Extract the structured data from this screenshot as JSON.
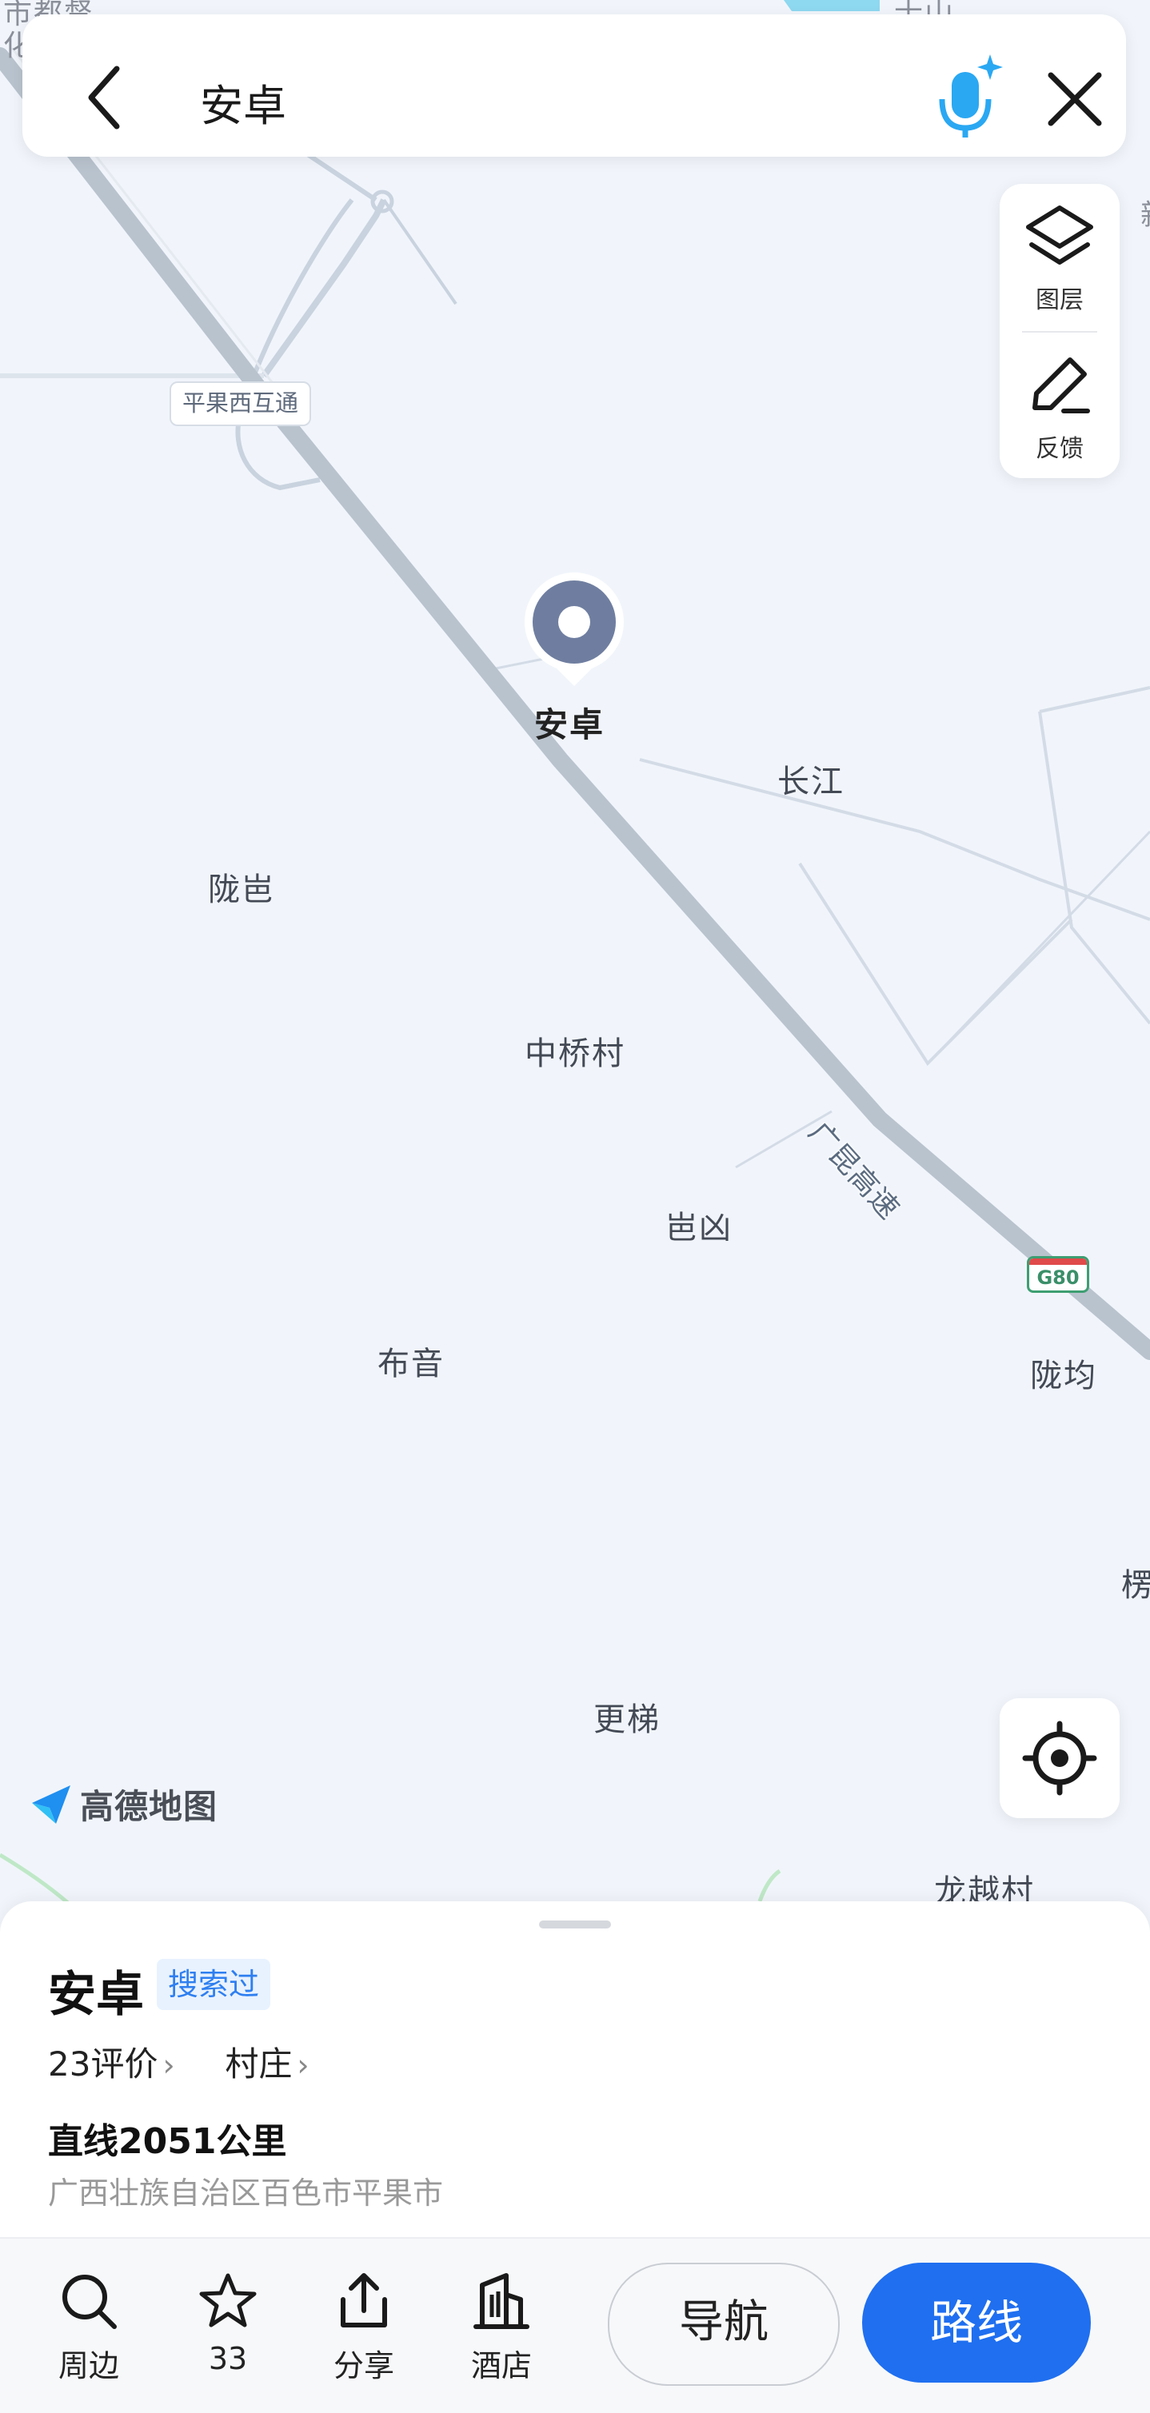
{
  "search": {
    "query": "安卓"
  },
  "map_tools": {
    "layers_label": "图层",
    "feedback_label": "反馈"
  },
  "map": {
    "pin_label": "安卓",
    "road_label": "平果西互通",
    "highway_name": "广昆高速",
    "highway_shield": "G80",
    "places": [
      {
        "name": "长江"
      },
      {
        "name": "陇岜"
      },
      {
        "name": "中桥村"
      },
      {
        "name": "岜凶"
      },
      {
        "name": "布音"
      },
      {
        "name": "陇均"
      },
      {
        "name": "更梯"
      },
      {
        "name": "龙越村"
      }
    ],
    "edge_labels": [
      "市都督",
      "化",
      "士山",
      "新",
      "楞"
    ]
  },
  "brand": {
    "name": "高德地图"
  },
  "place": {
    "name": "安卓",
    "badge": "搜索过",
    "reviews": "23评价",
    "category": "村庄",
    "distance": "直线2051公里",
    "address": "广西壮族自治区百色市平果市"
  },
  "actions": {
    "nearby": "周边",
    "favorite_count": "33",
    "share": "分享",
    "hotel": "酒店",
    "navigate": "导航",
    "route": "路线"
  }
}
